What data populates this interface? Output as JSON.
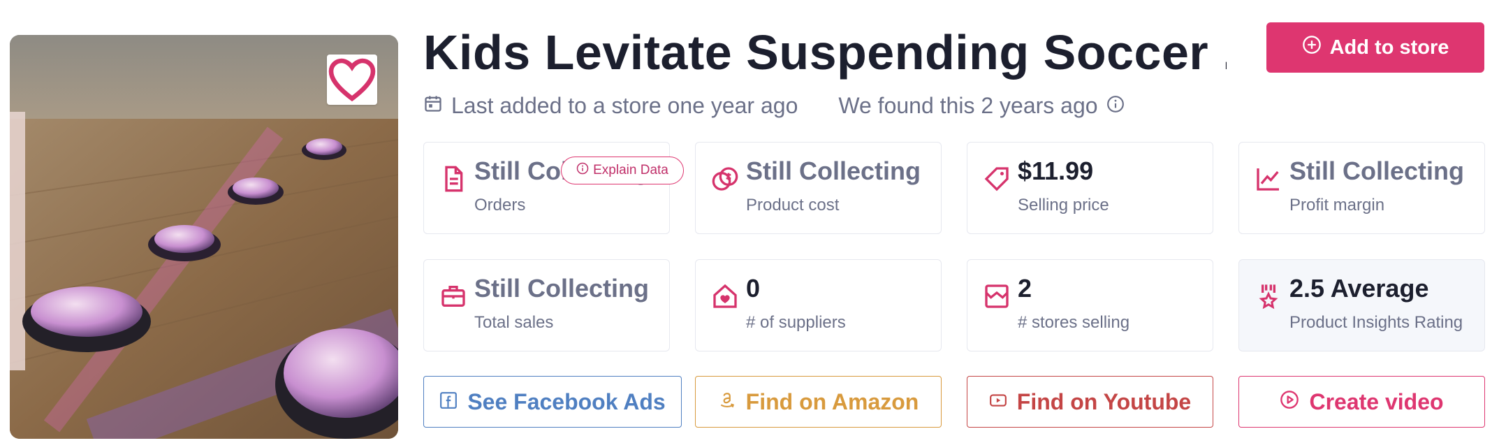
{
  "product": {
    "title": "Kids Levitate Suspending Soccer ...",
    "image_alt": "Hover soccer balls gliding on a wooden floor"
  },
  "header": {
    "add_button_label": "Add to store",
    "last_added": "Last added to a store one year ago",
    "found": "We found this 2 years ago"
  },
  "stats": [
    {
      "value": "Still Collecting",
      "label": "Orders",
      "icon": "document-icon"
    },
    {
      "value": "Still Collecting",
      "label": "Product cost",
      "icon": "coins-icon"
    },
    {
      "value": "$11.99",
      "label": "Selling price",
      "icon": "price-tag-icon"
    },
    {
      "value": "Still Collecting",
      "label": "Profit margin",
      "icon": "trend-chart-icon"
    },
    {
      "value": "Still Collecting",
      "label": "Total sales",
      "icon": "briefcase-icon"
    },
    {
      "value": "0",
      "label": "# of suppliers",
      "icon": "home-heart-icon"
    },
    {
      "value": "2",
      "label": "# stores selling",
      "icon": "store-icon"
    },
    {
      "value": "2.5 Average",
      "label": "Product Insights Rating",
      "icon": "award-icon"
    }
  ],
  "explain_badge": "Explain Data",
  "actions": [
    {
      "label": "See Facebook Ads",
      "color": "#4f7fc1",
      "icon": "facebook-icon"
    },
    {
      "label": "Find on Amazon",
      "color": "#d89a3d",
      "icon": "amazon-icon"
    },
    {
      "label": "Find on Youtube",
      "color": "#c44545",
      "icon": "youtube-icon"
    },
    {
      "label": "Create video",
      "color": "#de3670",
      "icon": "play-circle-icon"
    }
  ],
  "colors": {
    "accent": "#de3670",
    "icon_pink": "#d6336c",
    "text_dark": "#1c1f2e",
    "text_muted": "#6b7088"
  }
}
